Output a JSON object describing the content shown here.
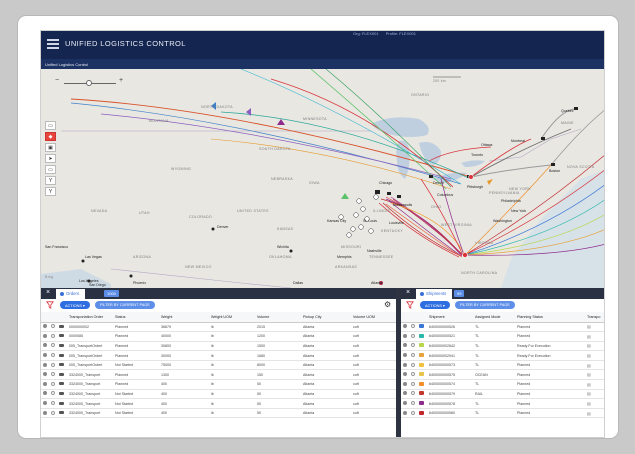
{
  "app": {
    "title": "UNIFIED LOGISTICS CONTROL",
    "subtitle": "Unified Logistics Control",
    "top_links": [
      "Org: FLEX001",
      "Profile: FLEX001"
    ]
  },
  "map": {
    "zoom_minus": "−",
    "zoom_plus": "+",
    "zoom_level": 0.48,
    "tools": [
      {
        "icon": "cursor-icon",
        "glyph": "▭",
        "active": false
      },
      {
        "icon": "layer-icon",
        "glyph": "◆",
        "active": true
      },
      {
        "icon": "select-icon",
        "glyph": "▣",
        "active": false
      },
      {
        "icon": "route-icon",
        "glyph": "➤",
        "active": false
      },
      {
        "icon": "polygon-icon",
        "glyph": "▭",
        "active": false
      },
      {
        "icon": "pin-icon",
        "glyph": "Y",
        "active": false
      },
      {
        "icon": "filter-pin-icon",
        "glyph": "Y",
        "active": false
      }
    ],
    "region_labels": [
      "ONTARIO",
      "NORTH DAKOTA",
      "MONTANA",
      "MINNESOTA",
      "SOUTH DAKOTA",
      "WYOMING",
      "NEBRASKA",
      "IOWA",
      "NEVADA",
      "UTAH",
      "COLORADO",
      "UNITED STATES",
      "KANSAS",
      "MISSOURI",
      "KENTUCKY",
      "ARIZONA",
      "NEW MEXICO",
      "OKLAHOMA",
      "ARKANSAS",
      "TENNESSEE",
      "NORTH CAROLINA",
      "ILLINOIS",
      "PENNSYLVANIA",
      "OHIO",
      "WEST VIRGINIA",
      "VIRGINIA",
      "NEW YORK",
      "MAINE",
      "NOVA SCOTIA"
    ],
    "cities": [
      "San Francisco",
      "Las Vegas",
      "Los Angeles",
      "San Diego",
      "Phoenix",
      "Denver",
      "Wichita",
      "Dallas",
      "Atlanta",
      "Chicago",
      "Detroit",
      "Toronto",
      "Ottawa",
      "Montreal",
      "Boston",
      "New York",
      "Philadelphia",
      "Washington",
      "Nashville",
      "Memphis",
      "Kansas City",
      "St. Louis",
      "Louisville",
      "Indianapolis",
      "Columbus",
      "Pittsburgh",
      "Quebec"
    ],
    "scale_label": "200 km",
    "map_credit": "Bing"
  },
  "orders_panel": {
    "tab_label": "Orders",
    "count": "1000",
    "actions_label": "ACTIONS ▾",
    "filter_label": "FILTER BY CURRENT PAGE",
    "columns": [
      "",
      "",
      "",
      "Transportation Order",
      "Status",
      "Weight",
      "Weight UOM",
      "Volume",
      "Pickup City",
      "Volume UOM"
    ],
    "rows": [
      [
        "0000000002",
        "Planned",
        "36879",
        "lb",
        "2015",
        "Atlanta",
        "cuft"
      ],
      [
        "0000085",
        "Planned",
        "40000",
        "lb",
        "1200",
        "Atlanta",
        "cuft"
      ],
      [
        "005_TransportOrderI",
        "Planned",
        "30800",
        "lb",
        "1500",
        "Atlanta",
        "cuft"
      ],
      [
        "005_TransportOrderI",
        "Planned",
        "30000",
        "lb",
        "1680",
        "Atlanta",
        "cuft"
      ],
      [
        "005_TransportOrderI",
        "Not Started",
        "75000",
        "lb",
        "8000",
        "Atlanta",
        "cuft"
      ],
      [
        "3324000_Transport",
        "Planned",
        "1300",
        "lb",
        "150",
        "Atlanta",
        "cuft"
      ],
      [
        "3324000_Transport",
        "Planned",
        "400",
        "lb",
        "50",
        "Atlanta",
        "cuft"
      ],
      [
        "3324000_Transport",
        "Not Started",
        "400",
        "lb",
        "50",
        "Atlanta",
        "cuft"
      ],
      [
        "3324000_Transport",
        "Not Started",
        "400",
        "lb",
        "50",
        "Atlanta",
        "cuft"
      ],
      [
        "3324000_Transport",
        "Not Started",
        "400",
        "lb",
        "50",
        "Atlanta",
        "cuft"
      ]
    ]
  },
  "shipments_panel": {
    "tab_label": "Shipments",
    "count": "99",
    "actions_label": "ACTIONS ▾",
    "filter_label": "FILTER BY CURRENT PAGE",
    "columns": [
      "",
      "",
      "",
      "Shipment",
      "Assigned Mode",
      "Planning Status",
      "Transpo"
    ],
    "rows": [
      {
        "id": "6400000000526",
        "mode": "TL",
        "status": "Planned",
        "color": "#3a76d6"
      },
      {
        "id": "6400000000521",
        "mode": "TL",
        "status": "Planned",
        "color": "#28b7a8"
      },
      {
        "id": "6400000002842",
        "mode": "TL",
        "status": "Ready For Execution",
        "color": "#b9d64b"
      },
      {
        "id": "6400000002941",
        "mode": "TL",
        "status": "Ready For Execution",
        "color": "#e8a23a"
      },
      {
        "id": "6400000000573",
        "mode": "TL",
        "status": "Planned",
        "color": "#f2c23e"
      },
      {
        "id": "6400000000575",
        "mode": "OCEAN",
        "status": "Planned",
        "color": "#e7c34b"
      },
      {
        "id": "6400000000574",
        "mode": "TL",
        "status": "Planned",
        "color": "#f08f2b"
      },
      {
        "id": "6400000000579",
        "mode": "RAIL",
        "status": "Planned",
        "color": "#c3372f"
      },
      {
        "id": "6400000000578",
        "mode": "TL",
        "status": "Planned",
        "color": "#8e2c8c"
      },
      {
        "id": "6400000000580",
        "mode": "TL",
        "status": "Planned",
        "color": "#c1272d"
      }
    ]
  },
  "colors": {
    "header": "#14254f",
    "accent": "#2f6ee0",
    "route_purple": "#8e2c8c",
    "route_red": "#d9333a",
    "route_teal": "#2aa89a"
  }
}
